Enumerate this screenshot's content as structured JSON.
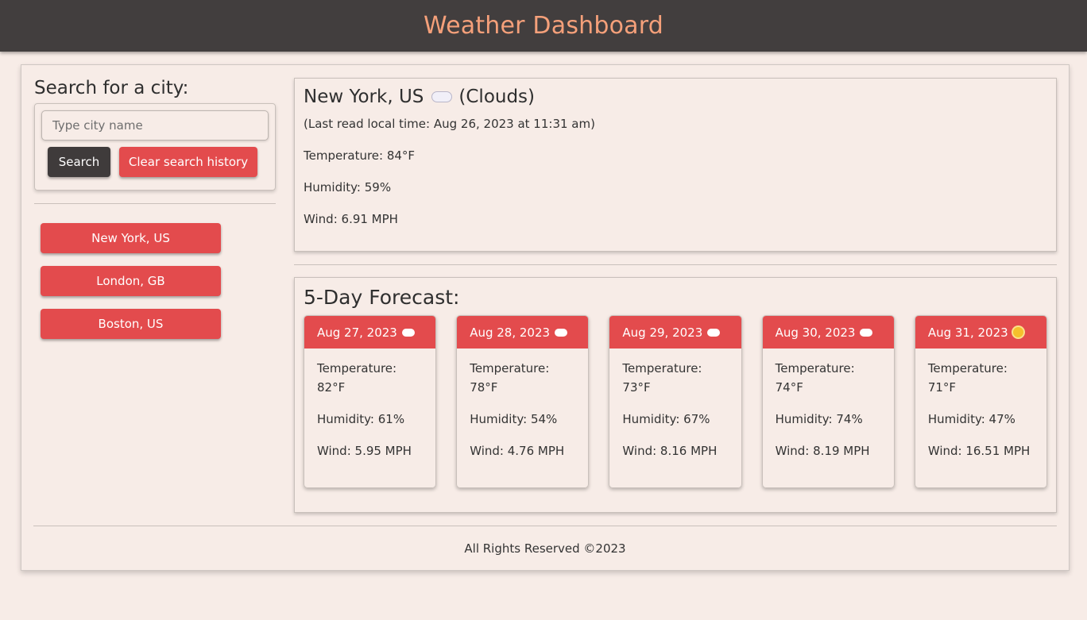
{
  "header": {
    "title": "Weather Dashboard"
  },
  "search": {
    "heading": "Search for a city:",
    "placeholder": "Type city name",
    "search_label": "Search",
    "clear_label": "Clear search history"
  },
  "history": [
    "New York, US",
    "London, GB",
    "Boston, US"
  ],
  "current": {
    "city": "New York, US",
    "icon": "cloud-icon",
    "condition": "(Clouds)",
    "time": "(Last read local time: Aug 26, 2023 at 11:31 am)",
    "temperature": "Temperature: 84°F",
    "humidity": "Humidity: 59%",
    "wind": "Wind: 6.91 MPH"
  },
  "forecast": {
    "heading": "5-Day Forecast:",
    "temp_label": "Temperature:",
    "days": [
      {
        "date": "Aug 27, 2023",
        "icon": "cloud-icon",
        "temp": "82°F",
        "humidity": "Humidity: 61%",
        "wind": "Wind: 5.95 MPH"
      },
      {
        "date": "Aug 28, 2023",
        "icon": "cloud-icon",
        "temp": "78°F",
        "humidity": "Humidity: 54%",
        "wind": "Wind: 4.76 MPH"
      },
      {
        "date": "Aug 29, 2023",
        "icon": "cloud-icon",
        "temp": "73°F",
        "humidity": "Humidity: 67%",
        "wind": "Wind: 8.16 MPH"
      },
      {
        "date": "Aug 30, 2023",
        "icon": "cloud-icon",
        "temp": "74°F",
        "humidity": "Humidity: 74%",
        "wind": "Wind: 8.19 MPH"
      },
      {
        "date": "Aug 31, 2023",
        "icon": "sun-icon",
        "temp": "71°F",
        "humidity": "Humidity: 47%",
        "wind": "Wind: 16.51 MPH"
      }
    ]
  },
  "footer": {
    "text": "All Rights Reserved ©2023"
  },
  "colors": {
    "header_bg": "#423e3e",
    "title": "#f5a07a",
    "accent_red": "#e34b4d",
    "page_bg": "#f7ece7"
  }
}
